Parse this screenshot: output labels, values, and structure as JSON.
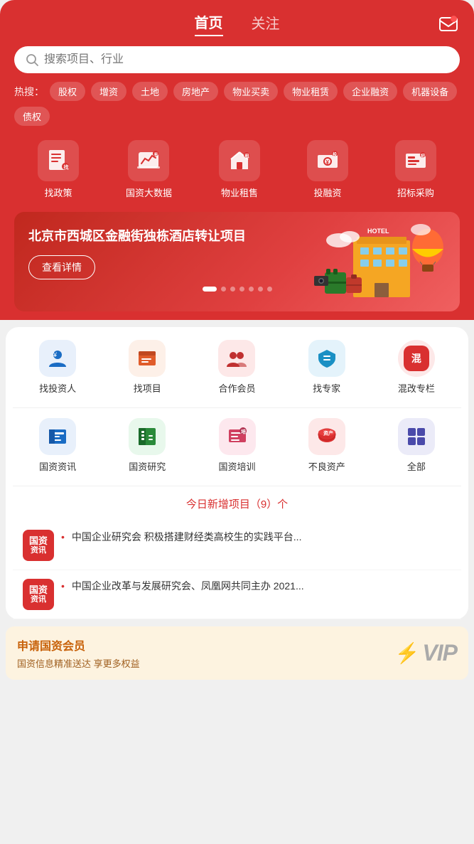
{
  "header": {
    "tab_home": "首页",
    "tab_follow": "关注",
    "active_tab": "home"
  },
  "search": {
    "placeholder": "搜索项目、行业"
  },
  "hot_search": {
    "label": "热搜：",
    "tags": [
      "股权",
      "增资",
      "土地",
      "房地产",
      "物业买卖",
      "物业租赁",
      "企业融资",
      "机器设备",
      "债权"
    ]
  },
  "icons": [
    {
      "id": "policy",
      "label": "找政策",
      "icon": "policy"
    },
    {
      "id": "data",
      "label": "国资大数据",
      "icon": "data"
    },
    {
      "id": "rent",
      "label": "物业租售",
      "icon": "rent"
    },
    {
      "id": "invest",
      "label": "投融资",
      "icon": "invest"
    },
    {
      "id": "bid",
      "label": "招标采购",
      "icon": "bid"
    }
  ],
  "banner": {
    "title": "北京市西城区金融街独栋酒店转让项目",
    "btn_label": "查看详情",
    "dots": 7,
    "active_dot": 0
  },
  "func_row1": [
    {
      "id": "investor",
      "label": "找投资人",
      "color": "#1a6cc4",
      "icon": "👤"
    },
    {
      "id": "project",
      "label": "找项目",
      "color": "#e05c2a",
      "icon": "📁"
    },
    {
      "id": "member",
      "label": "合作会员",
      "color": "#c03030",
      "icon": "🤝"
    },
    {
      "id": "expert",
      "label": "找专家",
      "color": "#1a90c4",
      "icon": "🎓"
    },
    {
      "id": "mixed",
      "label": "混改专栏",
      "color": "#d93030",
      "icon": "混"
    }
  ],
  "func_row2": [
    {
      "id": "news",
      "label": "国资资讯",
      "color": "#1a6cc4",
      "icon": "📰"
    },
    {
      "id": "research",
      "label": "国资研究",
      "color": "#2a8a3a",
      "icon": "📊"
    },
    {
      "id": "training",
      "label": "国资培训",
      "color": "#d04060",
      "icon": "📋"
    },
    {
      "id": "bad_asset",
      "label": "不良资产",
      "color": "#d93030",
      "icon": "🗄️"
    },
    {
      "id": "all",
      "label": "全部",
      "color": "#4a4aaa",
      "icon": "⊞"
    }
  ],
  "today_count": "今日新增项目（9）个",
  "news_items": [
    {
      "tag_line1": "国资",
      "tag_line2": "资讯",
      "dot": "•",
      "text": "中国企业研究会 积极搭建财经类高校生的实践平台..."
    },
    {
      "tag_line1": "国资",
      "tag_line2": "资讯",
      "dot": "•",
      "text": "中国企业改革与发展研究会、凤凰网共同主办 2021..."
    }
  ],
  "vip": {
    "title": "申请国资会员",
    "subtitle": "国资信息精准送达 享更多权益",
    "badge": "VIP"
  }
}
